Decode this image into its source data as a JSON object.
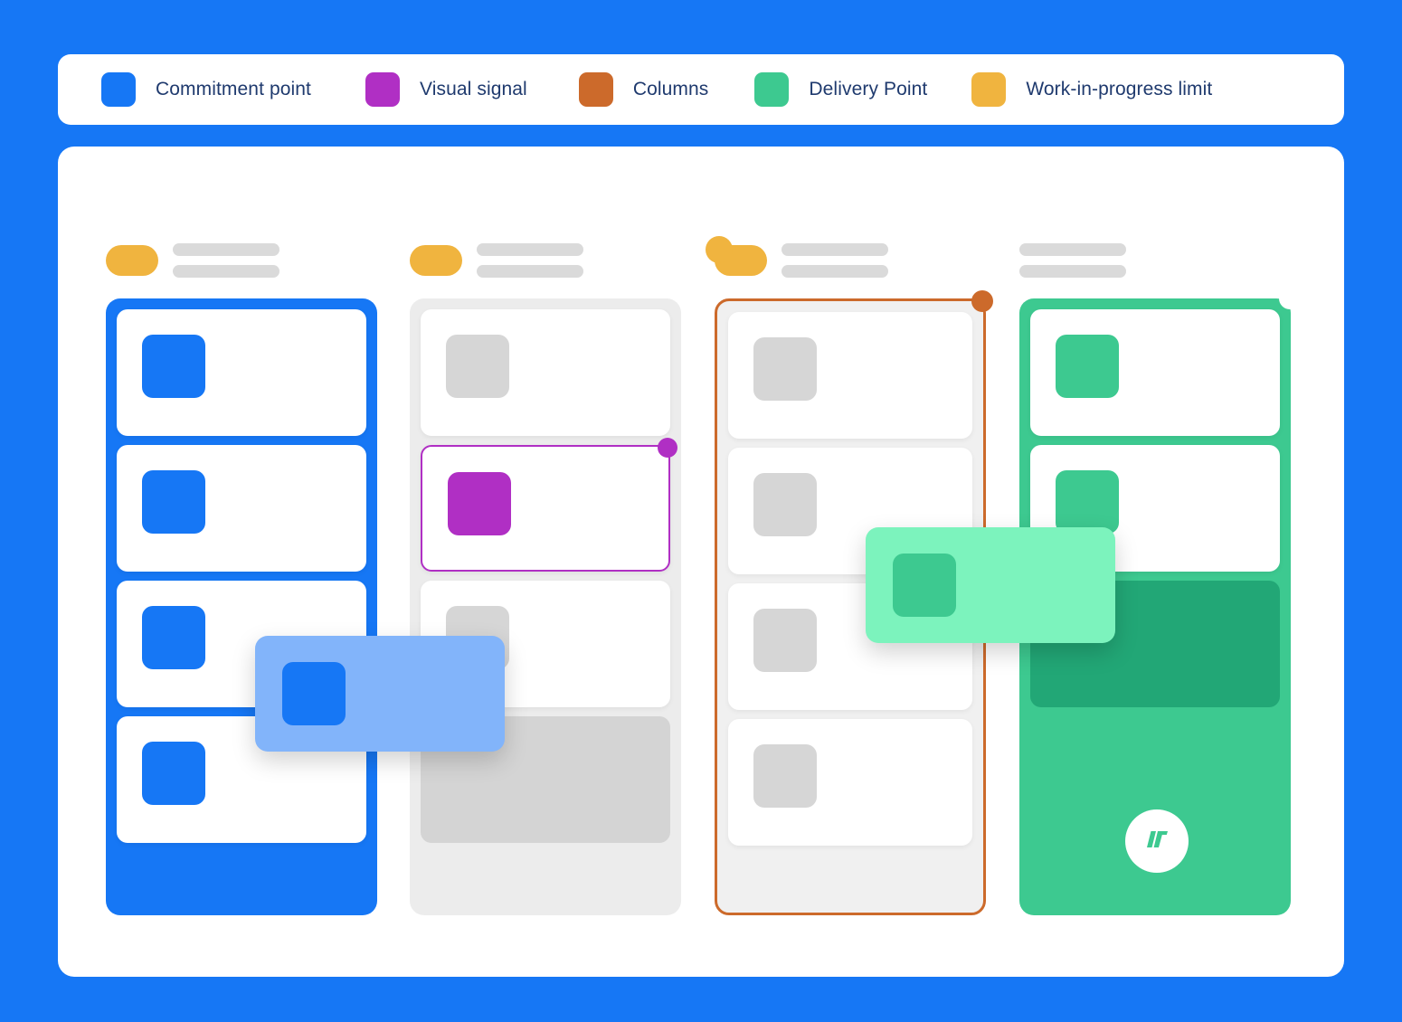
{
  "legend": {
    "items": [
      {
        "label": "Commitment point",
        "color": "#1677f5",
        "icon": "color-swatch-icon"
      },
      {
        "label": "Visual signal",
        "color": "#b02fc4",
        "icon": "color-swatch-icon"
      },
      {
        "label": "Columns",
        "color": "#cc6a2b",
        "icon": "color-swatch-icon"
      },
      {
        "label": "Delivery Point",
        "color": "#3dc990",
        "icon": "color-swatch-icon"
      },
      {
        "label": "Work-in-progress limit",
        "color": "#f0b43f",
        "icon": "color-swatch-icon"
      }
    ]
  },
  "board": {
    "background_color": "#1677f5",
    "panel_color": "#ffffff",
    "wip_pill_color": "#f0b43f",
    "placeholder_bar_color": "#dadada",
    "columns": [
      {
        "name": "commitment-point-column",
        "accent_color": "#1677f5",
        "fill": "solid",
        "has_wip_pill": true,
        "wip_pill_extra_dot": false,
        "corner_dot": "none",
        "cards": [
          {
            "type": "card",
            "square_color": "#1677f5"
          },
          {
            "type": "card",
            "square_color": "#1677f5"
          },
          {
            "type": "card",
            "square_color": "#1677f5"
          },
          {
            "type": "card",
            "square_color": "#1677f5"
          }
        ]
      },
      {
        "name": "visual-signal-column",
        "accent_color": "#ececec",
        "fill": "solid",
        "has_wip_pill": true,
        "wip_pill_extra_dot": false,
        "corner_dot": "none",
        "cards": [
          {
            "type": "card",
            "square_color": "#d6d6d6"
          },
          {
            "type": "card-highlighted",
            "square_color": "#b02fc4",
            "border_color": "#b02fc4",
            "dot_color": "#b02fc4"
          },
          {
            "type": "card",
            "square_color": "#d6d6d6"
          },
          {
            "type": "placeholder",
            "fill_color": "#d4d4d4"
          }
        ]
      },
      {
        "name": "columns-column",
        "accent_color": "#cc6a2b",
        "fill": "outline",
        "has_wip_pill": true,
        "wip_pill_extra_dot": true,
        "corner_dot": "#cc6a2b",
        "cards": [
          {
            "type": "card",
            "square_color": "#d6d6d6"
          },
          {
            "type": "card",
            "square_color": "#d6d6d6"
          },
          {
            "type": "card",
            "square_color": "#d6d6d6"
          },
          {
            "type": "card",
            "square_color": "#d6d6d6"
          }
        ]
      },
      {
        "name": "delivery-point-column",
        "accent_color": "#3dc990",
        "fill": "solid",
        "has_wip_pill": false,
        "wip_pill_extra_dot": false,
        "corner_dot": "#ffffff",
        "cards": [
          {
            "type": "card",
            "square_color": "#3dc990"
          },
          {
            "type": "card",
            "square_color": "#3dc990"
          },
          {
            "type": "placeholder",
            "fill_color": "#22a776"
          }
        ]
      }
    ],
    "floating_cards": [
      {
        "name": "dragging-card-blue",
        "fill_color": "#82b4fa",
        "square_color": "#1677f5"
      },
      {
        "name": "dragging-card-green",
        "fill_color": "#7cf3bd",
        "square_color": "#3dc990"
      }
    ],
    "logo": {
      "name": "jt-logo-mark",
      "color": "#3dc990",
      "badge_color": "#ffffff"
    }
  }
}
